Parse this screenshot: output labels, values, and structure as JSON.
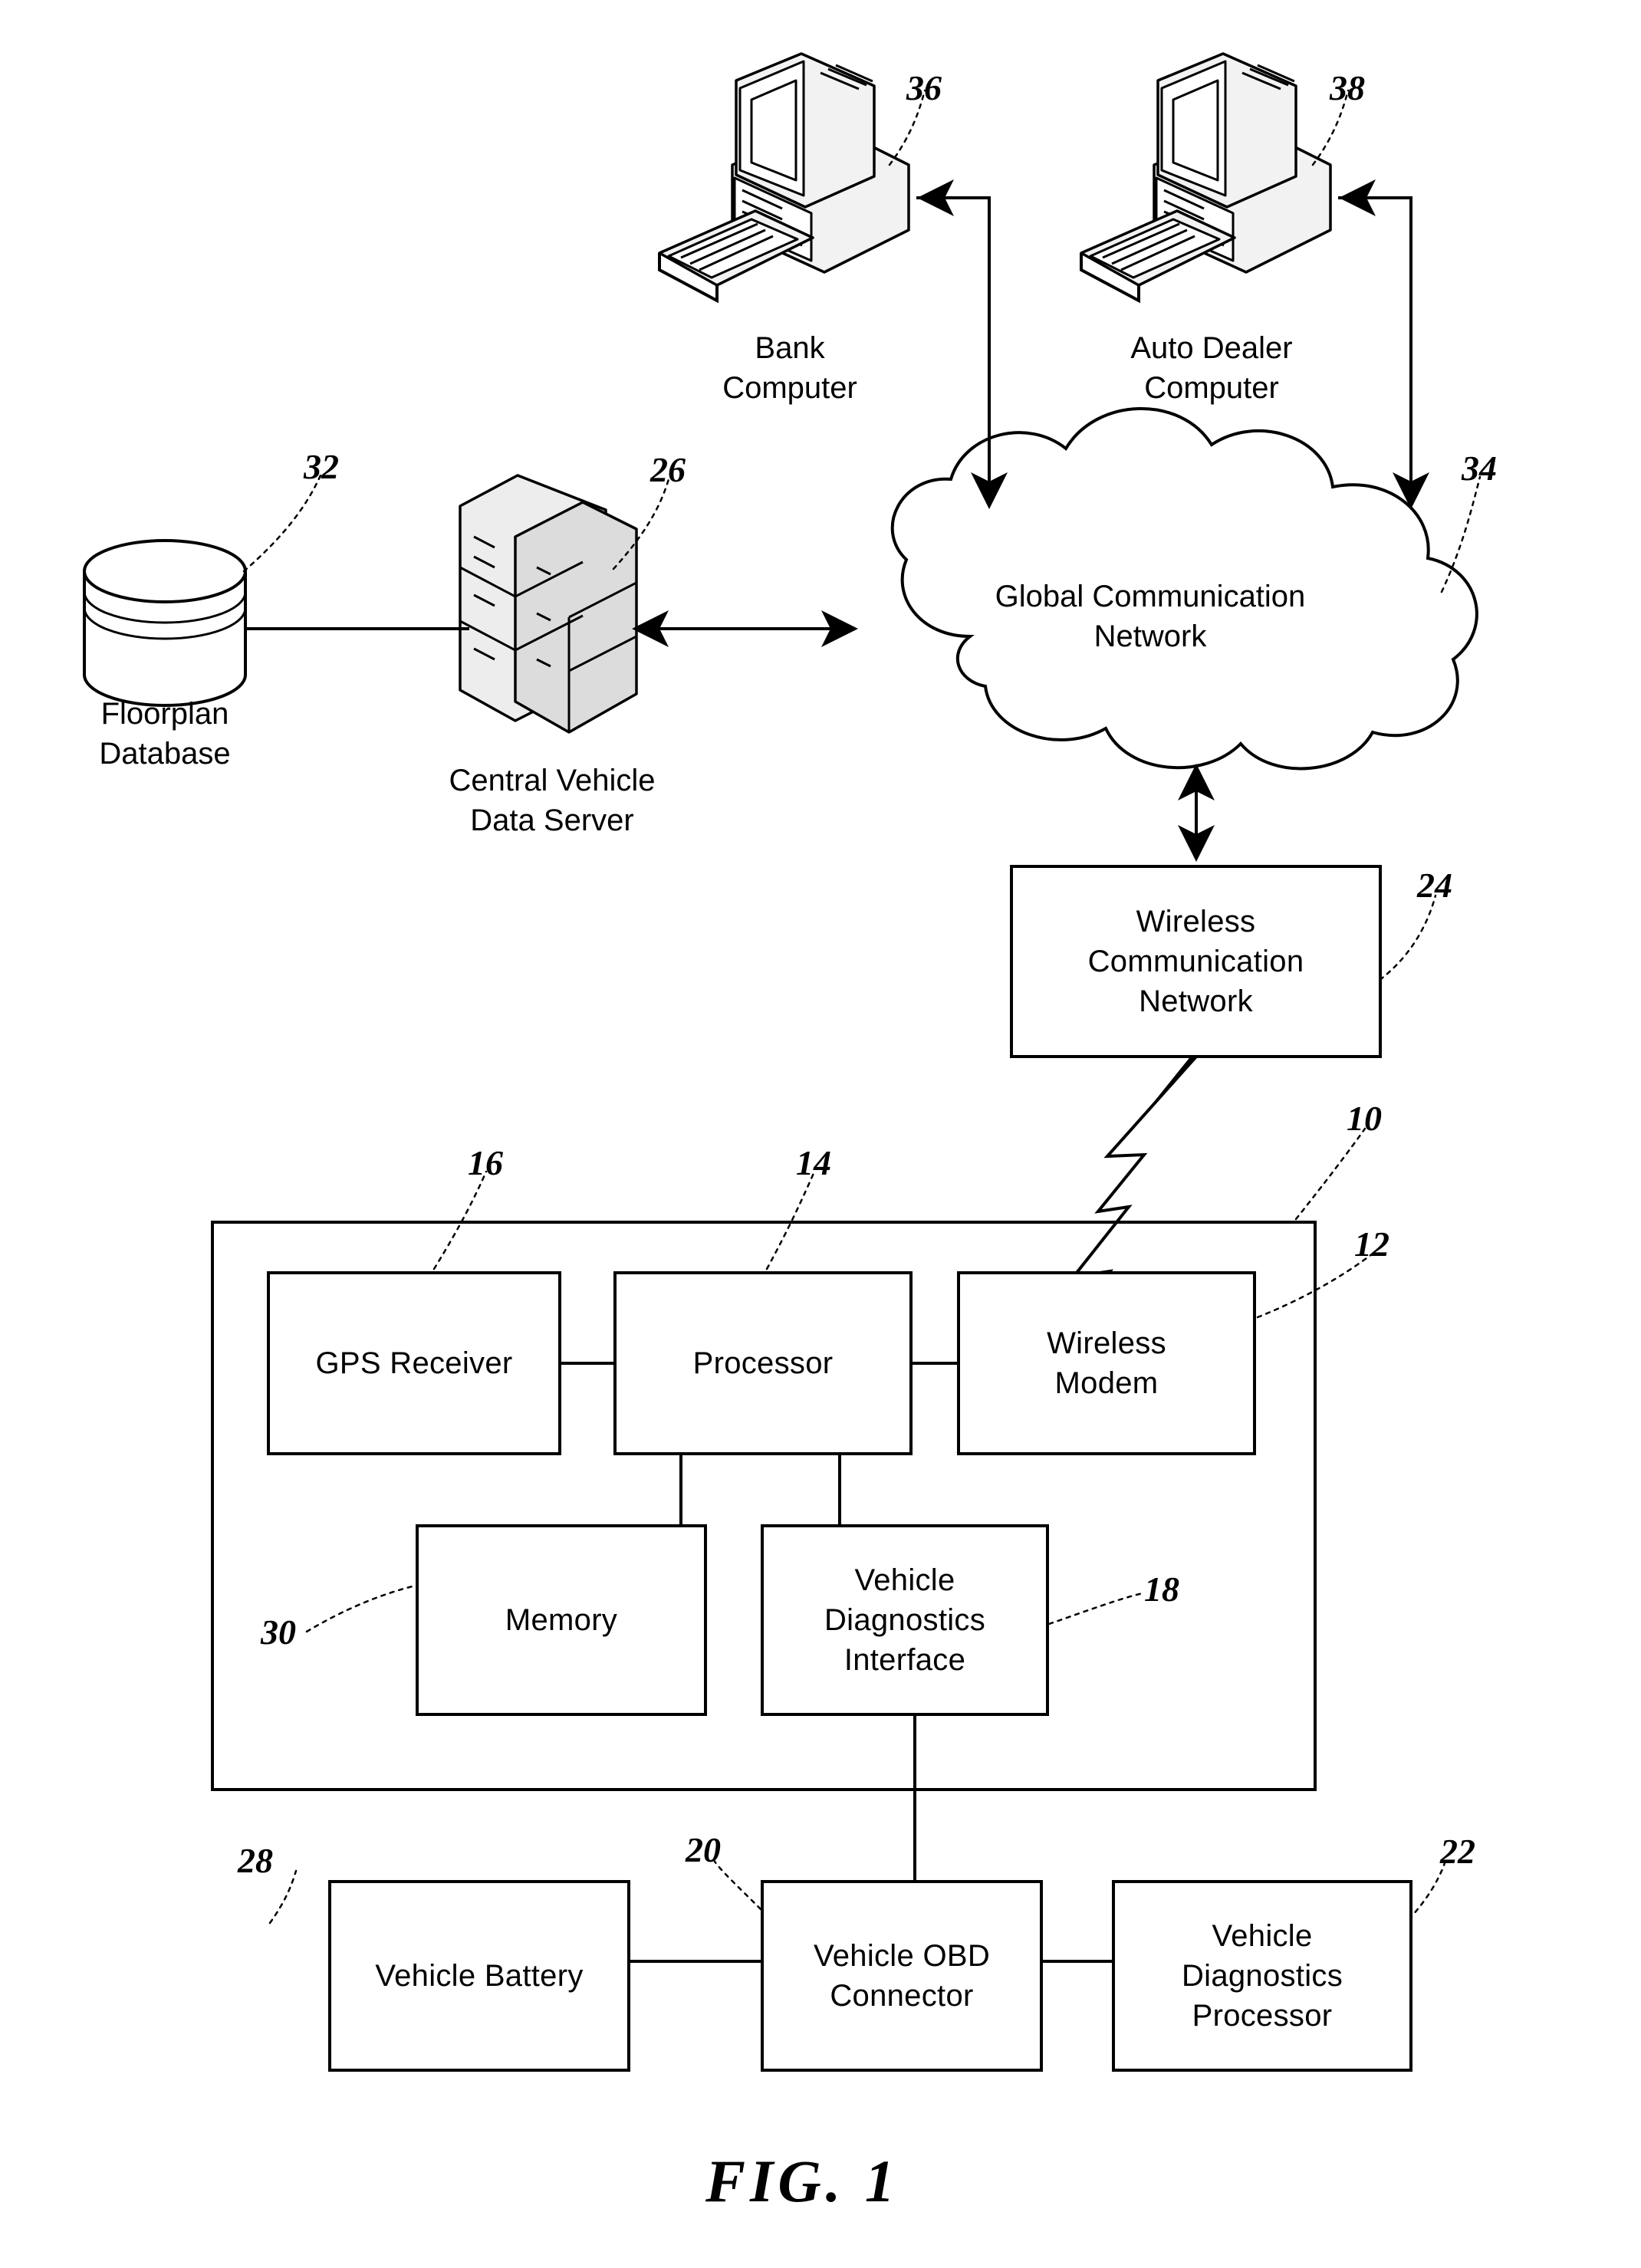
{
  "figure": {
    "title": "FIG. 1",
    "domain": "patent-block-diagram"
  },
  "nodes": {
    "bank_computer": {
      "label": "Bank\nComputer",
      "ref": "36"
    },
    "auto_dealer_computer": {
      "label": "Auto Dealer\nComputer",
      "ref": "38"
    },
    "floorplan_database": {
      "label": "Floorplan\nDatabase",
      "ref": "32"
    },
    "central_vehicle_data_server": {
      "label": "Central Vehicle\nData Server",
      "ref": "26"
    },
    "global_communication_network": {
      "label": "Global Communication\nNetwork",
      "ref": "34"
    },
    "wireless_communication_network": {
      "label": "Wireless\nCommunication\nNetwork",
      "ref": "24"
    },
    "onboard_unit": {
      "ref": "10"
    },
    "wireless_modem": {
      "label": "Wireless\nModem",
      "ref": "12"
    },
    "processor": {
      "label": "Processor",
      "ref": "14"
    },
    "gps_receiver": {
      "label": "GPS Receiver",
      "ref": "16"
    },
    "memory": {
      "label": "Memory",
      "ref": "30"
    },
    "vehicle_diagnostics_interface": {
      "label": "Vehicle\nDiagnostics\nInterface",
      "ref": "18"
    },
    "vehicle_battery": {
      "label": "Vehicle Battery",
      "ref": "28"
    },
    "vehicle_obd_connector": {
      "label": "Vehicle OBD\nConnector",
      "ref": "20"
    },
    "vehicle_diagnostics_processor": {
      "label": "Vehicle\nDiagnostics\nProcessor",
      "ref": "22"
    }
  },
  "connections": [
    {
      "from": "bank_computer",
      "to": "global_communication_network",
      "arrow": "single"
    },
    {
      "from": "auto_dealer_computer",
      "to": "global_communication_network",
      "arrow": "single"
    },
    {
      "from": "floorplan_database",
      "to": "central_vehicle_data_server",
      "arrow": "none"
    },
    {
      "from": "central_vehicle_data_server",
      "to": "global_communication_network",
      "arrow": "double"
    },
    {
      "from": "global_communication_network",
      "to": "wireless_communication_network",
      "arrow": "double"
    },
    {
      "from": "wireless_communication_network",
      "to": "wireless_modem",
      "arrow": "wireless-bolt"
    },
    {
      "from": "gps_receiver",
      "to": "processor",
      "arrow": "none"
    },
    {
      "from": "processor",
      "to": "wireless_modem",
      "arrow": "none"
    },
    {
      "from": "processor",
      "to": "memory",
      "arrow": "none"
    },
    {
      "from": "processor",
      "to": "vehicle_diagnostics_interface",
      "arrow": "none"
    },
    {
      "from": "vehicle_diagnostics_interface",
      "to": "vehicle_obd_connector",
      "arrow": "none"
    },
    {
      "from": "vehicle_battery",
      "to": "vehicle_obd_connector",
      "arrow": "none"
    },
    {
      "from": "vehicle_obd_connector",
      "to": "vehicle_diagnostics_processor",
      "arrow": "none"
    }
  ],
  "colors": {
    "ink": "#000000",
    "paper": "#ffffff",
    "shade_light": "#f2f2f2",
    "shade_mid": "#dcdcdc"
  }
}
